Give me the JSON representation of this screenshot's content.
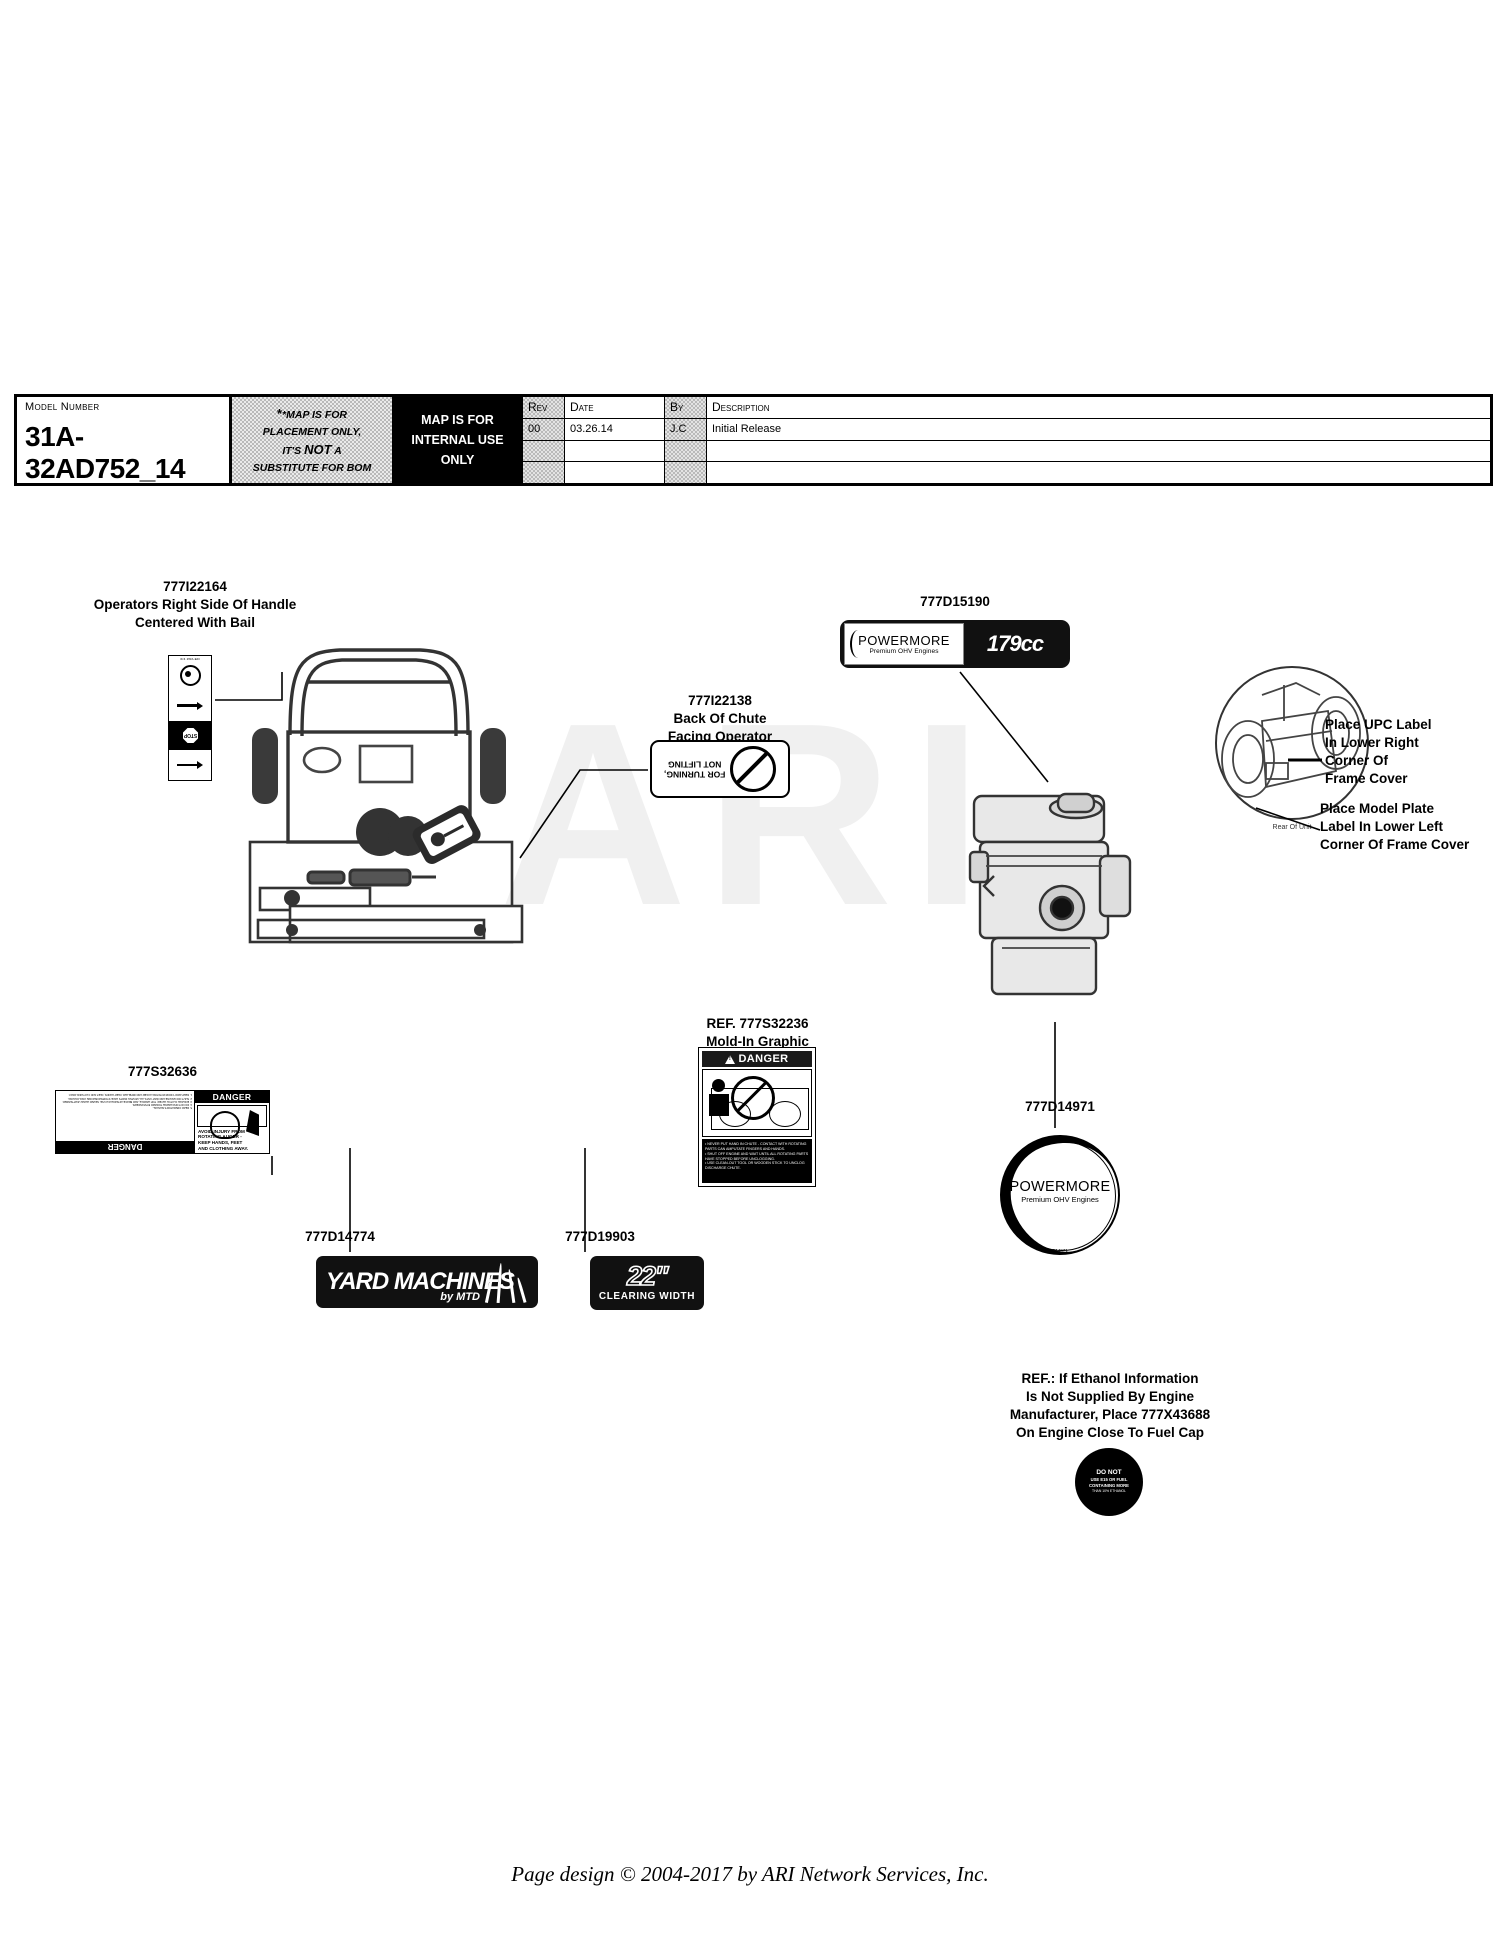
{
  "watermark": "ARI",
  "header": {
    "model_caption": "Model Number",
    "model_number": "31A-32AD752_14",
    "note_line1": "*MAP IS FOR",
    "note_line2": "PLACEMENT ONLY,",
    "note_line3_a": "IT'S",
    "note_line3_b": "NOT",
    "note_line3_c": "A",
    "note_line4": "SUBSTITUTE FOR BOM",
    "internal_line1": "MAP IS FOR",
    "internal_line2": "INTERNAL USE",
    "internal_line3": "ONLY",
    "columns": {
      "rev": "Rev",
      "date": "Date",
      "by": "By",
      "description": "Description"
    },
    "rows": [
      {
        "rev": "00",
        "date": "03.26.14",
        "by": "J.C",
        "description": "Initial Release"
      },
      {
        "rev": "",
        "date": "",
        "by": "",
        "description": ""
      },
      {
        "rev": "",
        "date": "",
        "by": "",
        "description": ""
      }
    ]
  },
  "callouts": {
    "c22164": {
      "part": "777I22164",
      "line1": "Operators Right Side Of Handle",
      "line2": "Centered With Bail"
    },
    "c22138": {
      "part": "777I22138",
      "line1": "Back Of Chute",
      "line2": "Facing Operator"
    },
    "c15190": {
      "part": "777D15190"
    },
    "c32636": {
      "part": "777S32636"
    },
    "c32236": {
      "line1": "REF. 777S32236",
      "line2": "Mold-In Graphic"
    },
    "c14971": {
      "part": "777D14971"
    },
    "c14774": {
      "part": "777D14774"
    },
    "c19903": {
      "part": "777D19903"
    },
    "upc": {
      "line1": "Place UPC Label",
      "line2": "In Lower Right",
      "line3": "Corner Of",
      "line4": "Frame Cover"
    },
    "model_plate": {
      "line1": "Place Model Plate",
      "line2": "Label In Lower Left",
      "line3": "Corner Of Frame Cover"
    },
    "rear_of_unit": "Rear Of Unit",
    "ethanol": {
      "line1": "REF.:  If Ethanol Information",
      "line2": "Is Not Supplied By Engine",
      "line3": "Manufacturer, Place 777X43688",
      "line4": "On Engine Close To Fuel Cap"
    }
  },
  "decals": {
    "d22164": {
      "top_text": "3/4 #9/LED",
      "stop": "STOP"
    },
    "d22138": {
      "line1": "FOR TURNING,",
      "line2": "NOT LIFTING"
    },
    "d15190": {
      "brand": "POWERMORE",
      "tagline": "Premium OHV Engines",
      "displacement": "179cc"
    },
    "d14971": {
      "brand": "POWERMORE",
      "tagline": "Premium OHV Engines",
      "code": "D14971"
    },
    "d32636": {
      "danger": "DANGER",
      "warn_line1": "AVOID INJURY FROM",
      "warn_line2": "ROTATING AUGER -",
      "warn_line3": "KEEP HANDS, FEET",
      "warn_line4": "AND CLOTHING AWAY.",
      "body_lines": [
        "1. KEEP AWAY FROM ROTATING AUGER AND IMPELLER. KEEP HANDS, FEET AND CLOTHING AWAY.",
        "2. SHUT OFF ENGINE AND WAIT UNTIL ALL MOVING PARTS HAVE STOPPED BEFORE UNCLOGGING.",
        "3. ENGAGE CLUTCH LEVER, TOP HANDLE, AND BRAKE AFTER EACH USE. NEVER LEAVE UNATTENDED.",
        "4. DO NOT DISCHARGE TOWARD BYSTANDERS.",
        "5. READ OPERATOR'S MANUAL."
      ]
    },
    "d32236": {
      "danger": "DANGER",
      "bullets": [
        "NEVER PUT HAND IN CHUTE - CONTACT WITH ROTATING PARTS CAN AMPUTATE FINGERS AND HANDS.",
        "SHUT OFF ENGINE AND WAIT UNTIL ALL ROTATING PARTS HAVE STOPPED BEFORE UNCLOGGING.",
        "USE CLEAN-OUT TOOL OR WOODEN STICK TO UNCLOG DISCHARGE CHUTE."
      ]
    },
    "d14774": {
      "brand_line1": "YARD",
      "brand_line2": "MACHINES",
      "by": "by MTD"
    },
    "d19903": {
      "size": "22″",
      "caption": "CLEARING WIDTH"
    },
    "d43688": {
      "line1": "DO NOT",
      "line2": "USE E15 OR FUEL",
      "line3": "CONTAINING MORE",
      "line4": "THAN 10% ETHANOL"
    }
  },
  "footer": "Page design © 2004-2017 by ARI Network Services, Inc."
}
